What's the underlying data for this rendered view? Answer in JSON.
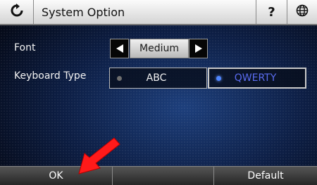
{
  "header": {
    "title": "System Option",
    "back_icon": "refresh-back-icon",
    "help_label": "?",
    "globe_icon": "globe-icon"
  },
  "font_row": {
    "label": "Font",
    "value": "Medium"
  },
  "keyboard_row": {
    "label": "Keyboard Type",
    "options": [
      {
        "label": "ABC",
        "selected": false
      },
      {
        "label": "QWERTY",
        "selected": true
      }
    ]
  },
  "footer": {
    "ok_label": "OK",
    "middle_label": "",
    "default_label": "Default"
  },
  "colors": {
    "selected_text": "#5a6cf0",
    "unselected_dot": "#6f6f6f",
    "selected_dot": "#4f86ff",
    "pointer": "#ff1a1a"
  }
}
